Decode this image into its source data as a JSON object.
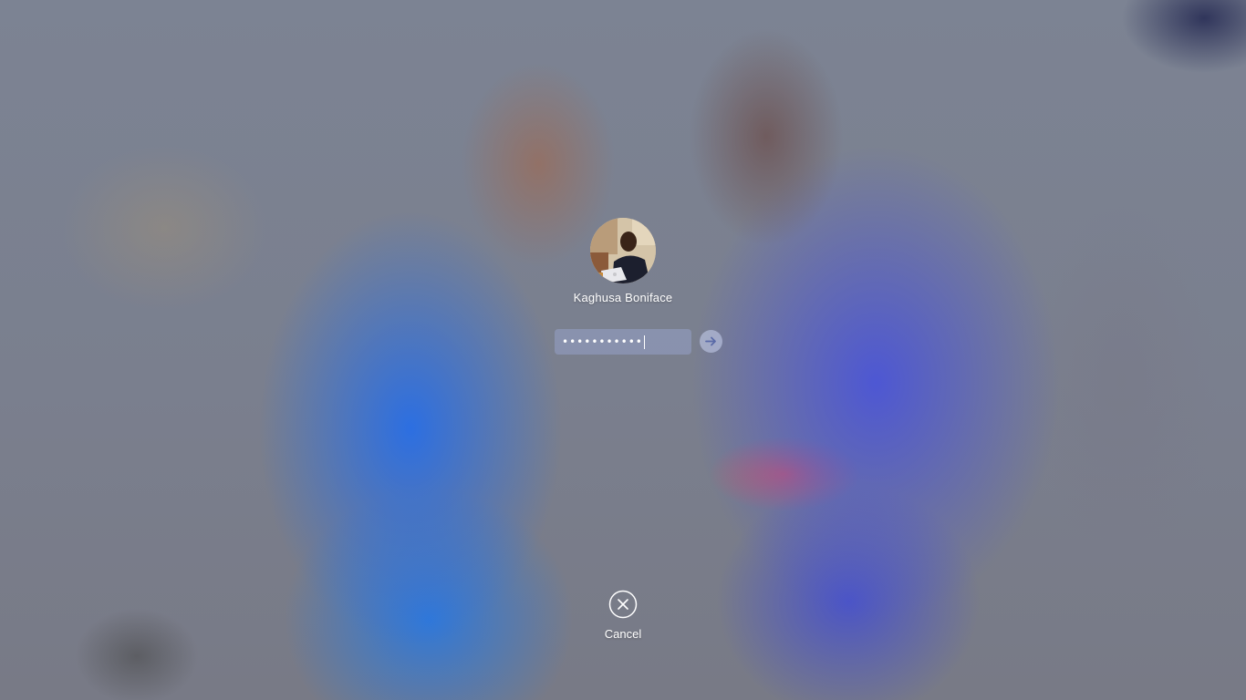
{
  "login": {
    "user_name": "Kaghusa Boniface",
    "password_mask": "•••••••••••",
    "avatar_description": "user-photo-avatar"
  },
  "actions": {
    "submit_icon": "arrow-right-icon",
    "cancel_icon": "close-circle-icon",
    "cancel_label": "Cancel"
  },
  "colors": {
    "field_bg": "#96a0c8",
    "text": "#ffffff",
    "wallpaper_base": "#7b8090"
  }
}
